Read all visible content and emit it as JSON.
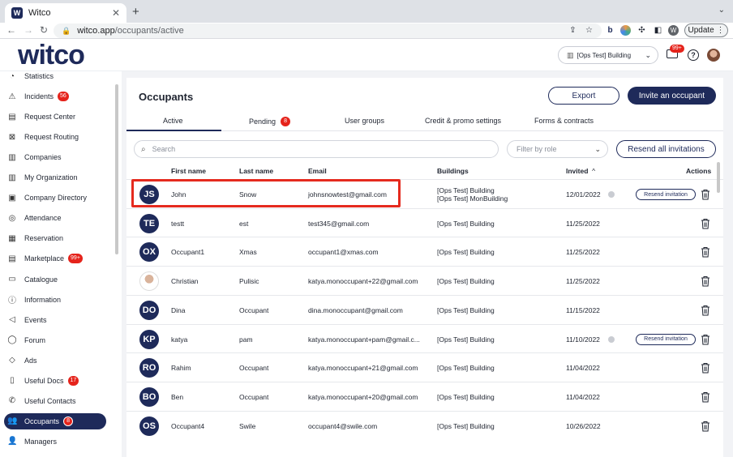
{
  "browser": {
    "tab_title": "Witco",
    "tab_favicon": "W",
    "new_tab": "+",
    "url_host": "witco.app",
    "url_path": "/occupants/active",
    "update_label": "Update",
    "profile_letter": "W"
  },
  "header": {
    "logo": "witco",
    "building_select": "[Ops Test] Building",
    "mail_badge": "99+"
  },
  "sidebar": {
    "items": [
      {
        "label": "Statistics",
        "icon": "chart-icon",
        "glyph": "◔",
        "badge": ""
      },
      {
        "label": "Incidents",
        "icon": "warning-icon",
        "glyph": "⚠",
        "badge": "56"
      },
      {
        "label": "Request Center",
        "icon": "chat-icon",
        "glyph": "▤",
        "badge": ""
      },
      {
        "label": "Request Routing",
        "icon": "routing-icon",
        "glyph": "⊠",
        "badge": ""
      },
      {
        "label": "Companies",
        "icon": "building-icon",
        "glyph": "▥",
        "badge": ""
      },
      {
        "label": "My Organization",
        "icon": "organization-icon",
        "glyph": "▥",
        "badge": ""
      },
      {
        "label": "Company Directory",
        "icon": "directory-icon",
        "glyph": "▣",
        "badge": ""
      },
      {
        "label": "Attendance",
        "icon": "check-circle-icon",
        "glyph": "◎",
        "badge": ""
      },
      {
        "label": "Reservation",
        "icon": "calendar-icon",
        "glyph": "▦",
        "badge": ""
      },
      {
        "label": "Marketplace",
        "icon": "shop-icon",
        "glyph": "▤",
        "badge": "99+"
      },
      {
        "label": "Catalogue",
        "icon": "book-icon",
        "glyph": "▭",
        "badge": ""
      },
      {
        "label": "Information",
        "icon": "info-icon",
        "glyph": "ⓘ",
        "badge": ""
      },
      {
        "label": "Events",
        "icon": "megaphone-icon",
        "glyph": "◁",
        "badge": ""
      },
      {
        "label": "Forum",
        "icon": "forum-icon",
        "glyph": "◯",
        "badge": ""
      },
      {
        "label": "Ads",
        "icon": "tag-icon",
        "glyph": "◇",
        "badge": ""
      },
      {
        "label": "Useful Docs",
        "icon": "document-icon",
        "glyph": "▯",
        "badge": "17"
      },
      {
        "label": "Useful Contacts",
        "icon": "phone-icon",
        "glyph": "✆",
        "badge": ""
      },
      {
        "label": "Occupants",
        "icon": "users-icon",
        "glyph": "👥",
        "badge": "8",
        "active": true
      },
      {
        "label": "Managers",
        "icon": "user-icon",
        "glyph": "👤",
        "badge": ""
      }
    ]
  },
  "main": {
    "title": "Occupants",
    "export_label": "Export",
    "invite_label": "Invite an occupant",
    "tabs": [
      {
        "label": "Active",
        "badge": ""
      },
      {
        "label": "Pending",
        "badge": "8"
      },
      {
        "label": "User groups",
        "badge": ""
      },
      {
        "label": "Credit & promo settings",
        "badge": ""
      },
      {
        "label": "Forms & contracts",
        "badge": ""
      }
    ],
    "search_placeholder": "Search",
    "role_filter": "Filter by role",
    "resend_all_label": "Resend all invitations"
  },
  "table": {
    "headers": {
      "first_name": "First name",
      "last_name": "Last name",
      "email": "Email",
      "buildings": "Buildings",
      "invited": "Invited",
      "invited_sort": "^",
      "actions": "Actions"
    },
    "resend_label": "Resend invitation",
    "rows": [
      {
        "initials": "JS",
        "first": "John",
        "last": "Snow",
        "email": "johnsnowtest@gmail.com",
        "buildings": [
          "[Ops Test] Building",
          "[Ops Test] MonBuilding"
        ],
        "invited": "12/01/2022",
        "resend": true,
        "photo": false
      },
      {
        "initials": "TE",
        "first": "testt",
        "last": "est",
        "email": "test345@gmail.com",
        "buildings": [
          "[Ops Test] Building"
        ],
        "invited": "11/25/2022",
        "resend": false,
        "photo": false
      },
      {
        "initials": "OX",
        "first": "Occupant1",
        "last": "Xmas",
        "email": "occupant1@xmas.com",
        "buildings": [
          "[Ops Test] Building"
        ],
        "invited": "11/25/2022",
        "resend": false,
        "photo": false
      },
      {
        "initials": "",
        "first": "Christian",
        "last": "Pulisic",
        "email": "katya.monoccupant+22@gmail.com",
        "buildings": [
          "[Ops Test] Building"
        ],
        "invited": "11/25/2022",
        "resend": false,
        "photo": true
      },
      {
        "initials": "DO",
        "first": "Dina",
        "last": "Occupant",
        "email": "dina.monoccupant@gmail.com",
        "buildings": [
          "[Ops Test] Building"
        ],
        "invited": "11/15/2022",
        "resend": false,
        "photo": false
      },
      {
        "initials": "KP",
        "first": "katya",
        "last": "pam",
        "email": "katya.monoccupant+pam@gmail.c...",
        "buildings": [
          "[Ops Test] Building"
        ],
        "invited": "11/10/2022",
        "resend": true,
        "photo": false
      },
      {
        "initials": "RO",
        "first": "Rahim",
        "last": "Occupant",
        "email": "katya.monoccupant+21@gmail.com",
        "buildings": [
          "[Ops Test] Building"
        ],
        "invited": "11/04/2022",
        "resend": false,
        "photo": false
      },
      {
        "initials": "BO",
        "first": "Ben",
        "last": "Occupant",
        "email": "katya.monoccupant+20@gmail.com",
        "buildings": [
          "[Ops Test] Building"
        ],
        "invited": "11/04/2022",
        "resend": false,
        "photo": false
      },
      {
        "initials": "OS",
        "first": "Occupant4",
        "last": "Swile",
        "email": "occupant4@swile.com",
        "buildings": [
          "[Ops Test] Building"
        ],
        "invited": "10/26/2022",
        "resend": false,
        "photo": false
      }
    ]
  },
  "colors": {
    "brand": "#1e2a5a",
    "badge": "#e5231b",
    "highlight": "#e52a1e"
  }
}
